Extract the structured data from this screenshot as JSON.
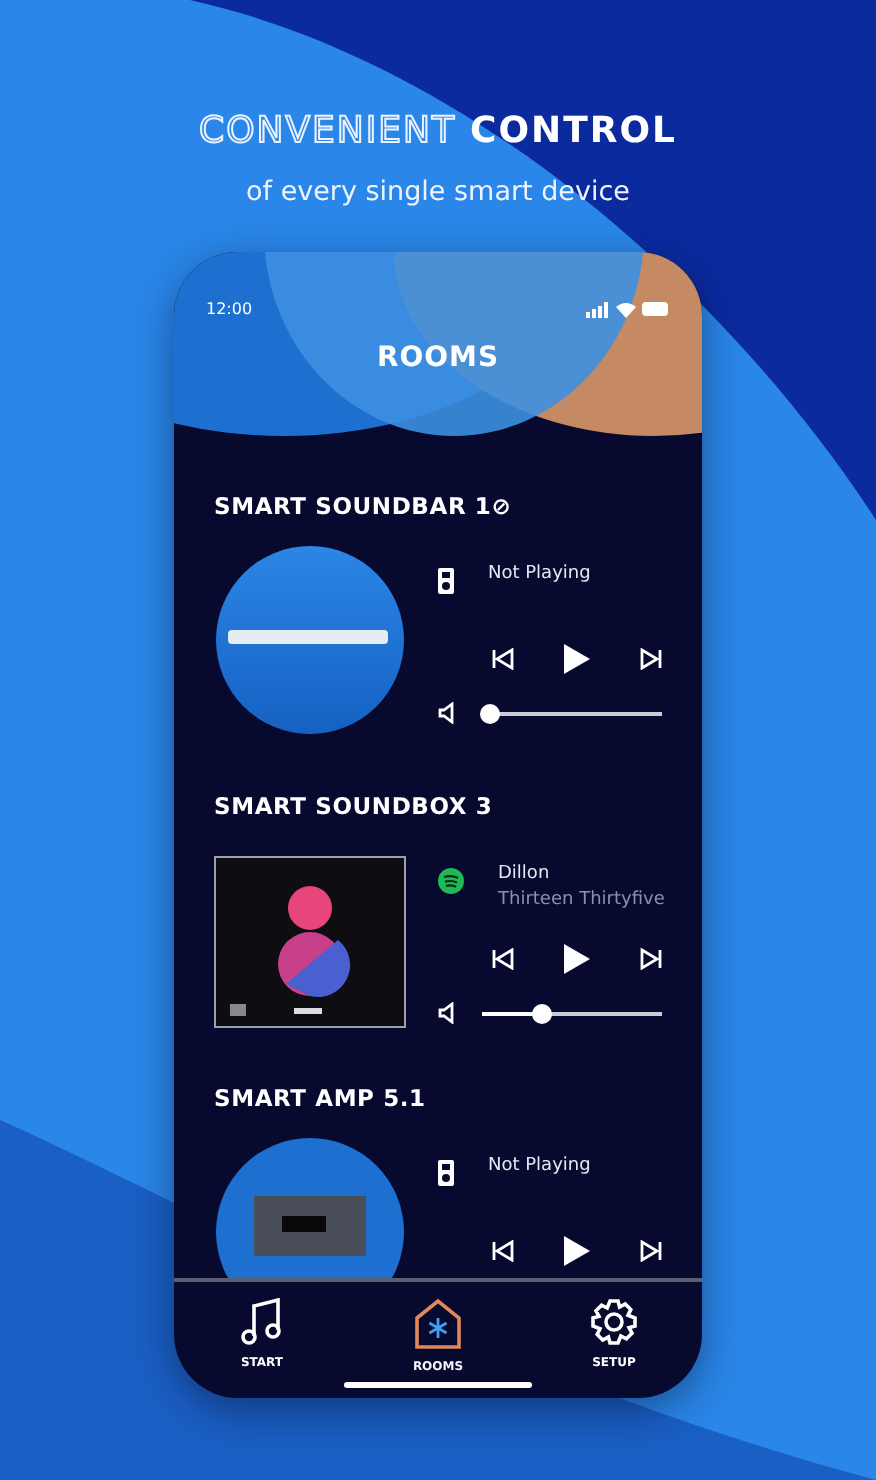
{
  "headline": {
    "outlined": "CONVENIENT",
    "solid": "CONTROL"
  },
  "subtitle": "of every single smart device",
  "phone": {
    "time": "12:00",
    "title": "ROOMS",
    "devices": [
      {
        "name": "SMART SOUNDBAR 1⊘",
        "kind": "soundbar",
        "source": {
          "kind": "speaker"
        },
        "track": "Not Playing",
        "level": 0.04
      },
      {
        "name": "SMART SOUNDBOX 3",
        "kind": "album",
        "source": {
          "kind": "spotify"
        },
        "track": "Dillon",
        "artist": "Thirteen Thirtyfive",
        "level": 0.33
      },
      {
        "name": "SMART AMP 5.1",
        "kind": "amp",
        "source": {
          "kind": "speaker"
        },
        "track": "Not Playing"
      }
    ],
    "tabs": [
      {
        "label": "START",
        "kind": "music",
        "selected": false
      },
      {
        "label": "ROOMS",
        "kind": "home",
        "selected": true
      },
      {
        "label": "SETUP",
        "kind": "gear",
        "selected": false
      }
    ]
  }
}
